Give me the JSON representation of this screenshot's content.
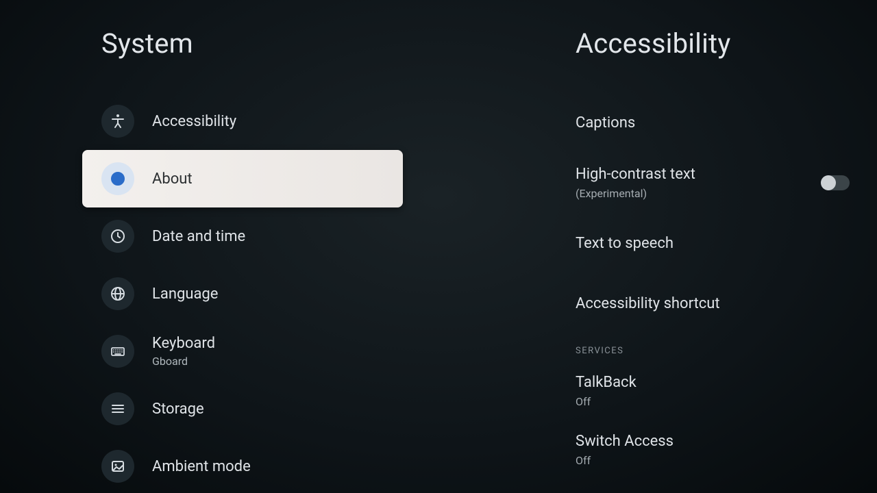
{
  "left": {
    "title": "System",
    "items": [
      {
        "label": "Accessibility",
        "sublabel": ""
      },
      {
        "label": "About",
        "sublabel": ""
      },
      {
        "label": "Date and time",
        "sublabel": ""
      },
      {
        "label": "Language",
        "sublabel": ""
      },
      {
        "label": "Keyboard",
        "sublabel": "Gboard"
      },
      {
        "label": "Storage",
        "sublabel": ""
      },
      {
        "label": "Ambient mode",
        "sublabel": ""
      }
    ]
  },
  "right": {
    "title": "Accessibility",
    "items": [
      {
        "label": "Captions",
        "sublabel": ""
      },
      {
        "label": "High-contrast text",
        "sublabel": "(Experimental)"
      },
      {
        "label": "Text to speech",
        "sublabel": ""
      },
      {
        "label": "Accessibility shortcut",
        "sublabel": ""
      }
    ],
    "section_label": "SERVICES",
    "services": [
      {
        "label": "TalkBack",
        "sublabel": "Off"
      },
      {
        "label": "Switch Access",
        "sublabel": "Off"
      }
    ]
  }
}
